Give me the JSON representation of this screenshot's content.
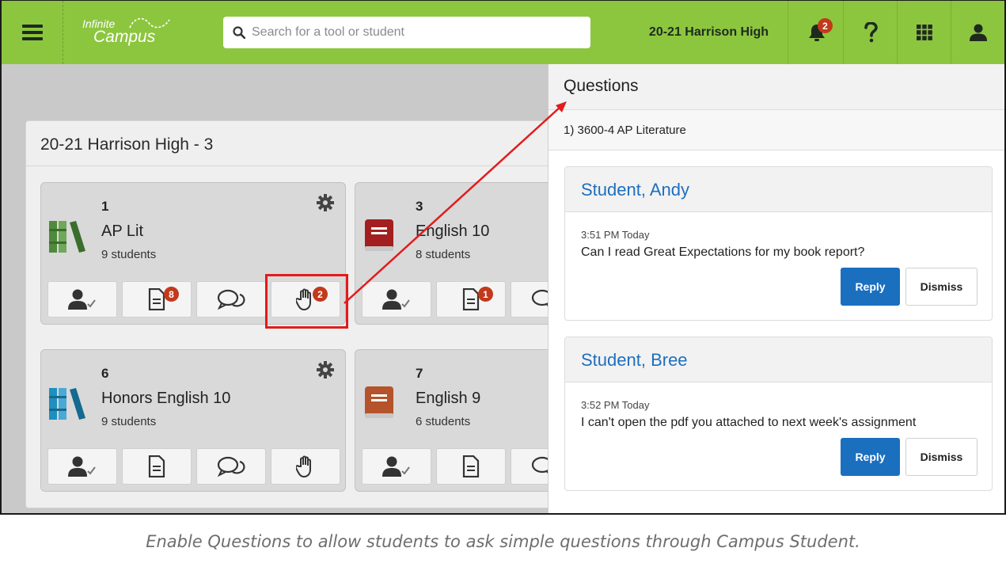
{
  "header": {
    "logo_line1": "Infinite",
    "logo_line2": "Campus",
    "search_placeholder": "Search for a tool or student",
    "school": "20-21 Harrison High",
    "notification_count": "2",
    "menu_icon": "hamburger-icon",
    "bell_icon": "bell-icon",
    "help_icon": "question-icon",
    "apps_icon": "grid-icon",
    "user_icon": "user-icon",
    "bar_color": "#8cc63f"
  },
  "section": {
    "title": "20-21 Harrison High - 3"
  },
  "cards": [
    {
      "period": "1",
      "name": "AP Lit",
      "students": "9 students",
      "book_color": "#4f8a3c",
      "assignments_badge": "8",
      "questions_badge": "2"
    },
    {
      "period": "3",
      "name": "English 10",
      "students": "8 students",
      "book_color": "#a31f1f",
      "assignments_badge": "1"
    },
    {
      "period": "6",
      "name": "Honors English 10",
      "students": "9 students",
      "book_color": "#1f8fbf"
    },
    {
      "period": "7",
      "name": "English 9",
      "students": "6 students",
      "book_color": "#b5532a"
    }
  ],
  "questions": {
    "title": "Questions",
    "course": "1) 3600-4 AP Literature",
    "items": [
      {
        "student": "Student, Andy",
        "time": "3:51 PM Today",
        "text": "Can I read Great Expectations for my book report?",
        "reply": "Reply",
        "dismiss": "Dismiss"
      },
      {
        "student": "Student, Bree",
        "time": "3:52 PM Today",
        "text": "I can't open the pdf you attached to next week's assignment",
        "reply": "Reply",
        "dismiss": "Dismiss"
      }
    ]
  },
  "caption": "Enable Questions to allow students to ask simple questions through Campus Student.",
  "colors": {
    "accent": "#1a6fbf",
    "badge": "#c2391b",
    "annotation": "#e31b1b"
  }
}
